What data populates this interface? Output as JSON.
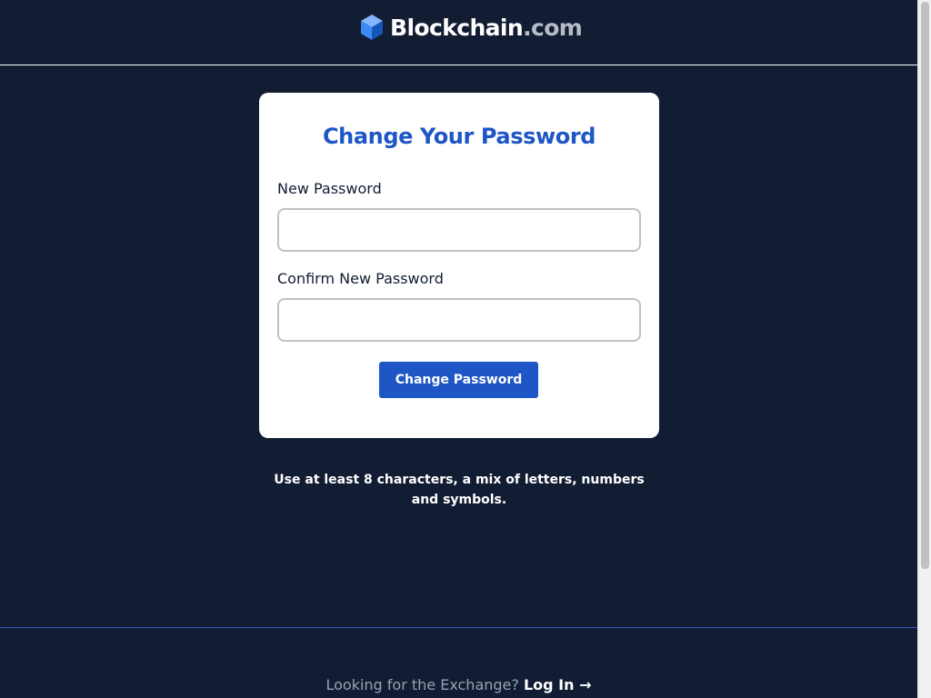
{
  "header": {
    "logo_name": "Blockchain",
    "logo_suffix": ".com",
    "logo_icon": "blockchain-cube-icon"
  },
  "form": {
    "title": "Change Your Password",
    "new_password": {
      "label": "New Password",
      "value": "",
      "placeholder": ""
    },
    "confirm_password": {
      "label": "Confirm New Password",
      "value": "",
      "placeholder": ""
    },
    "submit_label": "Change Password"
  },
  "hint": "Use at least 8 characters, a mix of letters, numbers and symbols.",
  "footer": {
    "prompt": "Looking for the Exchange?",
    "link_label": "Log In",
    "link_icon": "arrow-right-icon"
  },
  "colors": {
    "background": "#121d33",
    "brand_blue": "#1e56c5",
    "card": "#ffffff",
    "footer_text": "#98a1b2"
  }
}
